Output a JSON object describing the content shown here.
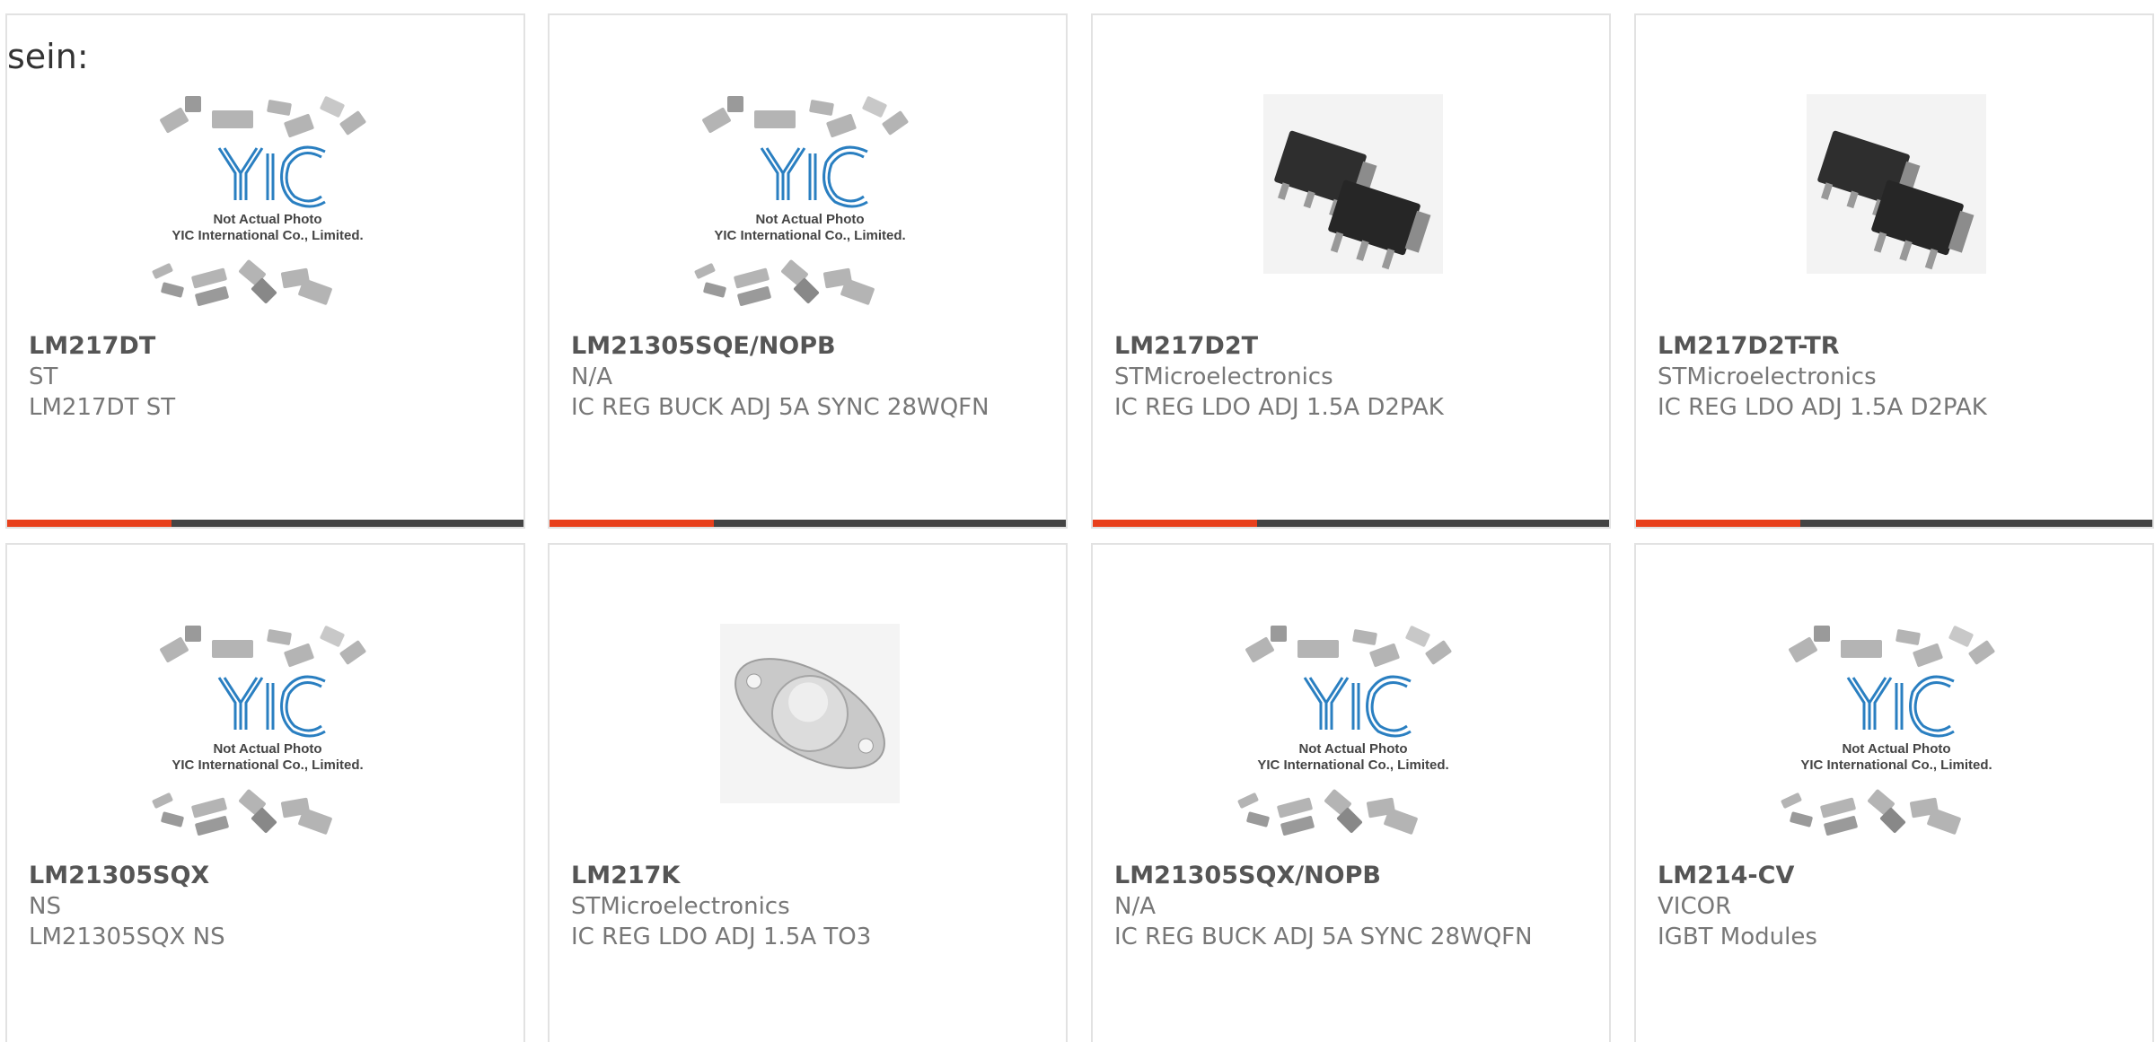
{
  "heading": "sein:",
  "placeholder": {
    "line1": "Not Actual Photo",
    "line2": "YIC International Co., Limited.",
    "logo": "YIC"
  },
  "products": [
    {
      "part": "LM217DT",
      "manufacturer": "ST",
      "description": "LM217DT ST",
      "image": "yic-placeholder"
    },
    {
      "part": "LM21305SQE/NOPB",
      "manufacturer": "N/A",
      "description": "IC REG BUCK ADJ 5A SYNC 28WQFN",
      "image": "yic-placeholder"
    },
    {
      "part": "LM217D2T",
      "manufacturer": "STMicroelectronics",
      "description": "IC REG LDO ADJ 1.5A D2PAK",
      "image": "d2pak-package"
    },
    {
      "part": "LM217D2T-TR",
      "manufacturer": "STMicroelectronics",
      "description": "IC REG LDO ADJ 1.5A D2PAK",
      "image": "d2pak-package"
    },
    {
      "part": "LM21305SQX",
      "manufacturer": "NS",
      "description": "LM21305SQX NS",
      "image": "yic-placeholder"
    },
    {
      "part": "LM217K",
      "manufacturer": "STMicroelectronics",
      "description": "IC REG LDO ADJ 1.5A TO3",
      "image": "to3-package"
    },
    {
      "part": "LM21305SQX/NOPB",
      "manufacturer": "N/A",
      "description": "IC REG BUCK ADJ 5A SYNC 28WQFN",
      "image": "yic-placeholder"
    },
    {
      "part": "LM214-CV",
      "manufacturer": "VICOR",
      "description": "IGBT Modules",
      "image": "yic-placeholder"
    }
  ],
  "colors": {
    "accent": "#e8401c",
    "bar": "#444444",
    "logo_blue": "#2a7fc1"
  }
}
